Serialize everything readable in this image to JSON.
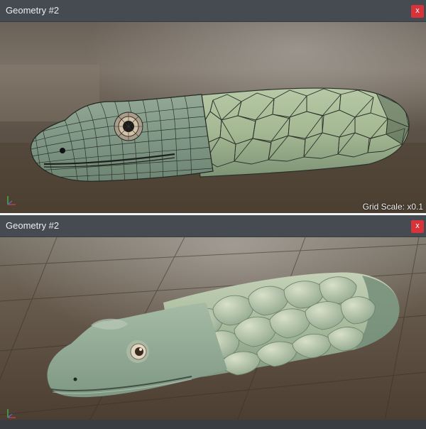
{
  "panels": [
    {
      "title": "Geometry #2",
      "close_label": "x",
      "grid_scale": "Grid Scale: x0.1"
    },
    {
      "title": "Geometry #2",
      "close_label": "x"
    }
  ],
  "colors": {
    "titlebar": "#464b51",
    "close_button": "#d8323a",
    "mesh_fill": "#7f9a84",
    "scale_fill": "#9fb896",
    "smooth_fill": "#9cb69e"
  },
  "icons": [
    "close-icon",
    "axis-gizmo-icon"
  ]
}
